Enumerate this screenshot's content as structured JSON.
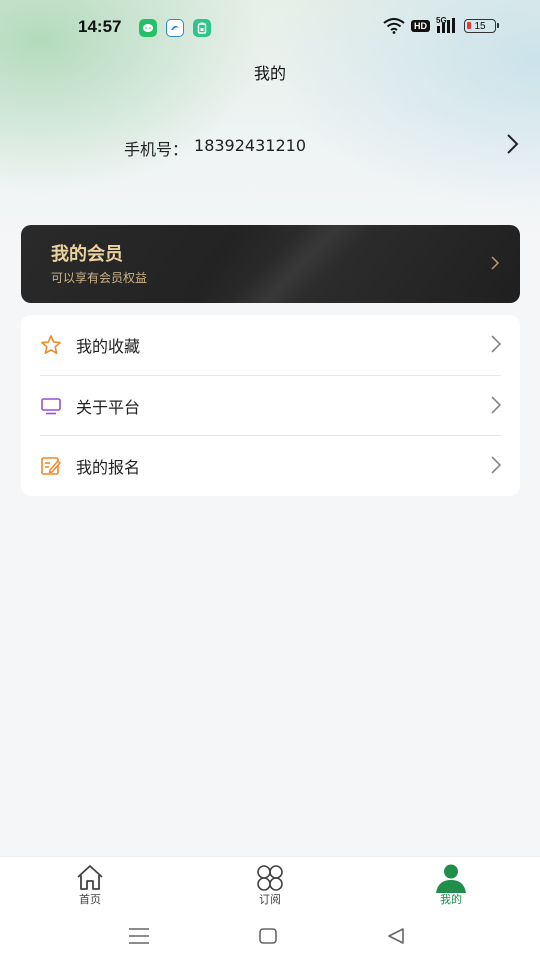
{
  "status_bar": {
    "time": "14:57",
    "network": "5G",
    "hd_badge": "HD",
    "battery": "15"
  },
  "header": {
    "title": "我的"
  },
  "profile": {
    "phone_label": "手机号：",
    "phone_number": "18392431210"
  },
  "vip": {
    "title": "我的会员",
    "subtitle": "可以享有会员权益",
    "title_color": "#ecd2a0"
  },
  "menu": {
    "items": [
      {
        "label": "我的收藏",
        "icon": "star-icon",
        "color": "#f0892a"
      },
      {
        "label": "关于平台",
        "icon": "monitor-icon",
        "color": "#9b4fd0"
      },
      {
        "label": "我的报名",
        "icon": "edit-icon",
        "color": "#f0892a"
      }
    ]
  },
  "tabs": [
    {
      "label": "首页",
      "icon": "home-icon",
      "active": false
    },
    {
      "label": "订阅",
      "icon": "grid-icon",
      "active": false
    },
    {
      "label": "我的",
      "icon": "user-icon",
      "active": true
    }
  ],
  "colors": {
    "accent": "#1f8f4a"
  }
}
